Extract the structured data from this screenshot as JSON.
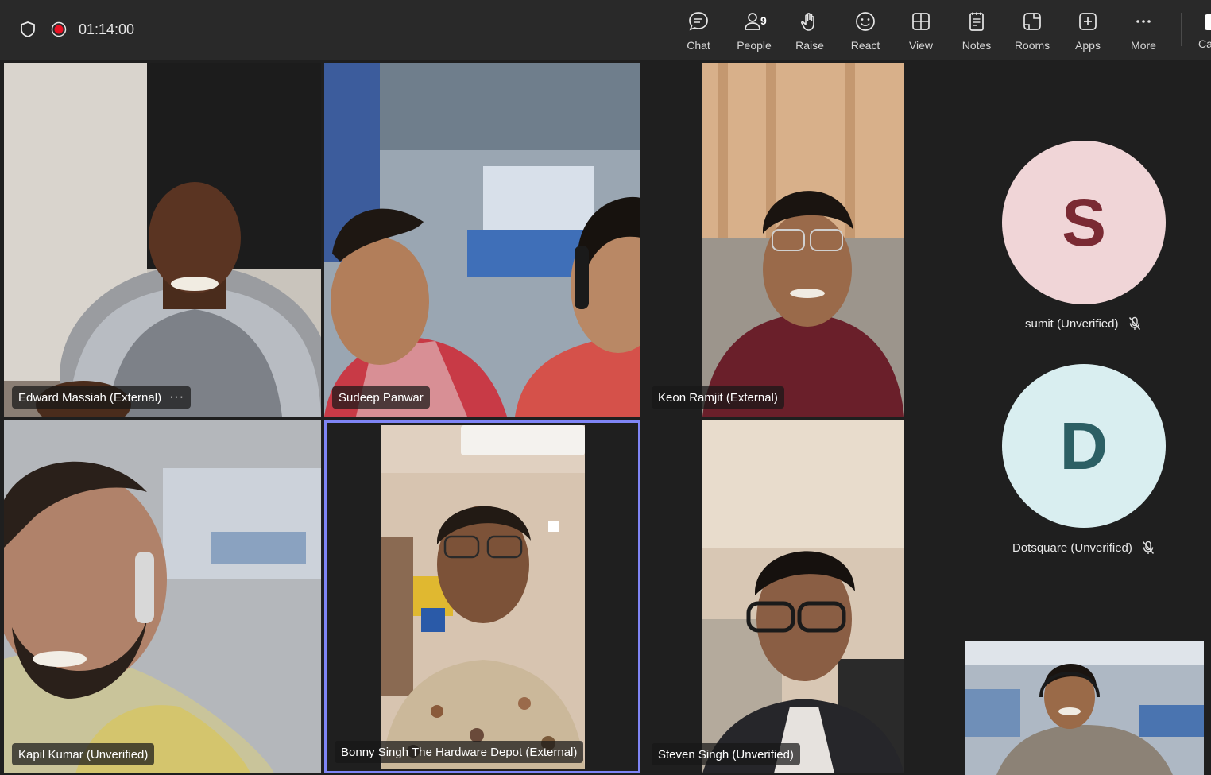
{
  "call": {
    "timer": "01:14:00"
  },
  "toolbar": {
    "chat": "Chat",
    "people": "People",
    "people_count": "9",
    "raise": "Raise",
    "react": "React",
    "view": "View",
    "notes": "Notes",
    "rooms": "Rooms",
    "apps": "Apps",
    "more": "More",
    "camera": "Camera"
  },
  "participants": {
    "p1": {
      "name": "Edward Massiah (External)",
      "more": "···"
    },
    "p2": {
      "name": "Sudeep Panwar"
    },
    "p3": {
      "name": "Keon Ramjit (External)"
    },
    "p4": {
      "name": "Kapil Kumar (Unverified)"
    },
    "p5": {
      "name": "Bonny Singh The Hardware Depot (External)"
    },
    "p6": {
      "name": "Steven Singh (Unverified)"
    },
    "a1": {
      "initial": "S",
      "name": "sumit (Unverified)",
      "bg": "#f0d5d7",
      "fg": "#7a2a33"
    },
    "a2": {
      "initial": "D",
      "name": "Dotsquare (Unverified)",
      "bg": "#d9eef0",
      "fg": "#2c5f64"
    }
  },
  "colors": {
    "active_speaker_border": "#7f85f5",
    "record_red": "#e81123"
  }
}
